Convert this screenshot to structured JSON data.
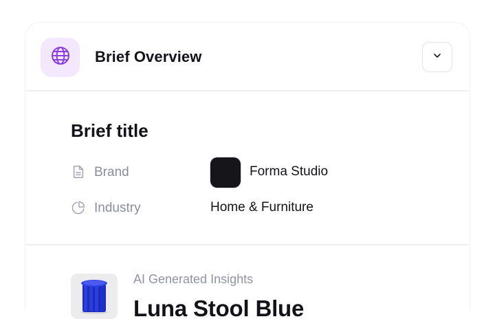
{
  "header": {
    "title": "Brief Overview",
    "icon": "globe-icon",
    "toggle_icon": "chevron-down-icon",
    "accent_color": "#8b3fe0",
    "badge_color": "#f3e8fd"
  },
  "brief": {
    "title": "Brief title",
    "fields": [
      {
        "label": "Brand",
        "icon": "document-icon",
        "value": "Forma Studio"
      },
      {
        "label": "Industry",
        "icon": "pie-chart-icon",
        "value": "Home & Furniture"
      }
    ]
  },
  "insights": {
    "label": "AI Generated Insights",
    "product_name": "Luna Stool Blue",
    "product_color": "#1f32c8"
  }
}
